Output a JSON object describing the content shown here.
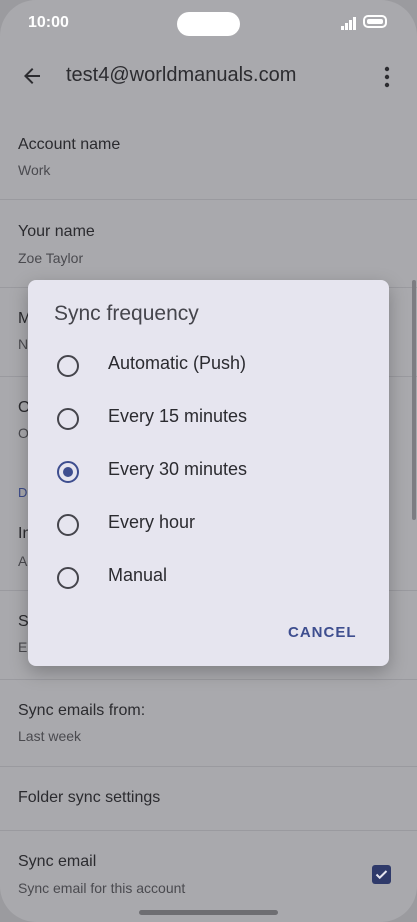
{
  "status_bar": {
    "time": "10:00"
  },
  "app_bar": {
    "title": "test4@worldmanuals.com"
  },
  "settings": [
    {
      "title": "Account name",
      "subtitle": "Work"
    },
    {
      "title": "Your name",
      "subtitle": "Zoe Taylor"
    },
    {
      "title": "M",
      "subtitle": "N"
    },
    {
      "title": "O",
      "subtitle": "O"
    },
    {
      "section": "D"
    },
    {
      "title": "In",
      "subtitle": "A"
    },
    {
      "title": "S",
      "subtitle": "E"
    },
    {
      "title": "Sync emails from:",
      "subtitle": "Last week"
    },
    {
      "title": "Folder sync settings"
    },
    {
      "title": "Sync email",
      "subtitle": "Sync email for this account",
      "checked": true
    }
  ],
  "dialog": {
    "title": "Sync frequency",
    "options": [
      {
        "label": "Automatic (Push)",
        "selected": false
      },
      {
        "label": "Every 15 minutes",
        "selected": false
      },
      {
        "label": "Every 30 minutes",
        "selected": true
      },
      {
        "label": "Every hour",
        "selected": false
      },
      {
        "label": "Manual",
        "selected": false
      }
    ],
    "cancel_label": "CANCEL"
  },
  "colors": {
    "accent": "#3e4e8f",
    "dialog_bg": "#e6e5ef",
    "scrim_bg": "#a9a9ad"
  }
}
